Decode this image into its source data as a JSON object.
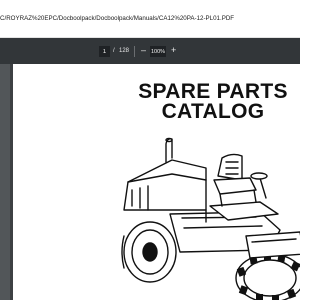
{
  "browser": {
    "address": "C/ROYRAZ%20EPC/Docboolpack/Docboolpack/Manuals/CA12%20PA-12-PL01.PDF"
  },
  "pdf_toolbar": {
    "current_page": "1",
    "separator": "/",
    "total_pages": "128",
    "zoom_out_icon": "minus-icon",
    "zoom_level": "100%",
    "zoom_in_icon": "plus-icon"
  },
  "document": {
    "title_line1": "SPARE PARTS",
    "title_line2": "CATALOG",
    "illustration": "padfoot-soil-compactor-line-drawing"
  },
  "colors": {
    "toolbar_bg": "#323639",
    "viewer_bg": "#525659",
    "page_bg": "#ffffff"
  }
}
